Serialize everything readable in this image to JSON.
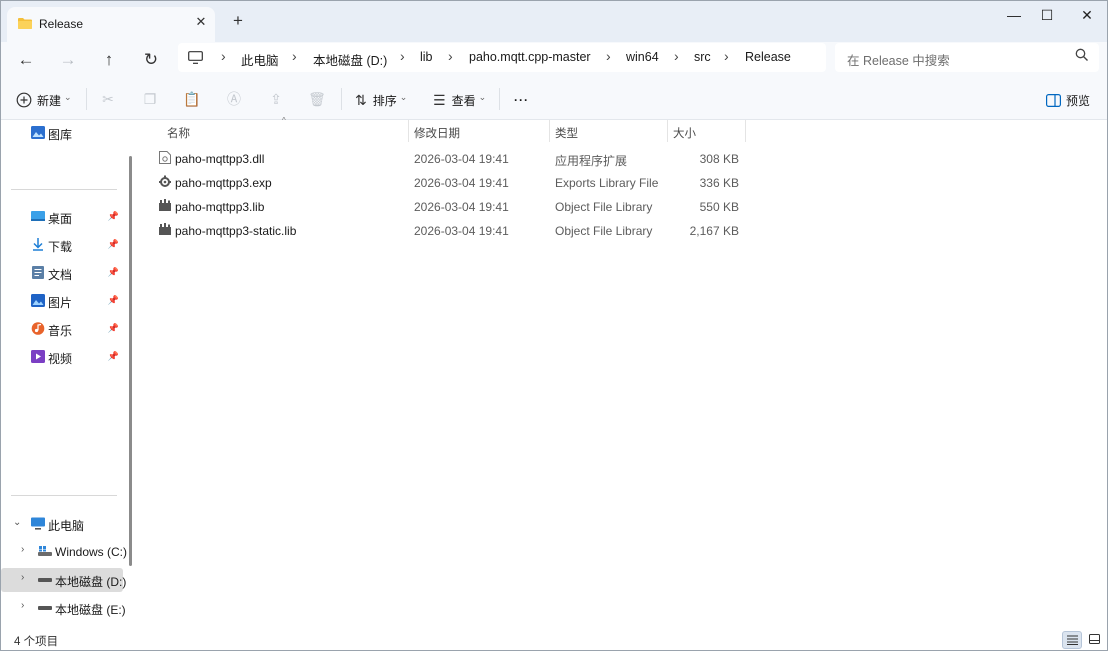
{
  "tab": {
    "title": "Release",
    "close": "✕",
    "new": "+"
  },
  "window_controls": {
    "minimize": "—",
    "maximize": "☐",
    "close": "✕"
  },
  "nav_buttons": {
    "back": "←",
    "forward": "→",
    "up": "↑",
    "refresh": "↻"
  },
  "breadcrumb": [
    "此电脑",
    "本地磁盘 (D:)",
    "lib",
    "paho.mqtt.cpp-master",
    "win64",
    "src",
    "Release"
  ],
  "breadcrumb_sep": "›",
  "search": {
    "placeholder": "在 Release 中搜索"
  },
  "toolbar": {
    "new_label": "新建",
    "sort_label": "排序",
    "view_label": "查看",
    "more_label": "···",
    "preview_label": "预览",
    "dropdown": "⌄"
  },
  "sidebar": {
    "top": [
      {
        "label": "图库",
        "icon": "gallery-icon"
      }
    ],
    "pinned": [
      {
        "label": "桌面",
        "icon": "desktop-icon"
      },
      {
        "label": "下载",
        "icon": "download-icon"
      },
      {
        "label": "文档",
        "icon": "document-icon"
      },
      {
        "label": "图片",
        "icon": "pictures-icon"
      },
      {
        "label": "音乐",
        "icon": "music-icon"
      },
      {
        "label": "视频",
        "icon": "video-icon"
      }
    ],
    "pin_glyph": "📌",
    "this_pc": {
      "label": "此电脑",
      "icon": "computer-icon"
    },
    "drives": [
      {
        "label": "Windows (C:)",
        "icon": "windows-drive-icon",
        "selected": false
      },
      {
        "label": "本地磁盘 (D:)",
        "icon": "drive-icon",
        "selected": true
      },
      {
        "label": "本地磁盘 (E:)",
        "icon": "drive-icon",
        "selected": false
      }
    ]
  },
  "columns": {
    "name": "名称",
    "date": "修改日期",
    "type": "类型",
    "size": "大小"
  },
  "files": [
    {
      "name": "paho-mqttpp3.dll",
      "date": "2026-03-04 19:41",
      "type": "应用程序扩展",
      "size": "308 KB",
      "icon": "dll-file-icon"
    },
    {
      "name": "paho-mqttpp3.exp",
      "date": "2026-03-04 19:41",
      "type": "Exports Library File",
      "size": "336 KB",
      "icon": "exp-file-icon"
    },
    {
      "name": "paho-mqttpp3.lib",
      "date": "2026-03-04 19:41",
      "type": "Object File Library",
      "size": "550 KB",
      "icon": "lib-file-icon"
    },
    {
      "name": "paho-mqttpp3-static.lib",
      "date": "2026-03-04 19:41",
      "type": "Object File Library",
      "size": "2,167 KB",
      "icon": "lib-file-icon"
    }
  ],
  "status": {
    "count": "4 个项目"
  },
  "colors": {
    "accent": "#0067c0",
    "tabbar": "#e8eef6",
    "chrome": "#f7f9fc",
    "selected": "#dcdcdc"
  }
}
